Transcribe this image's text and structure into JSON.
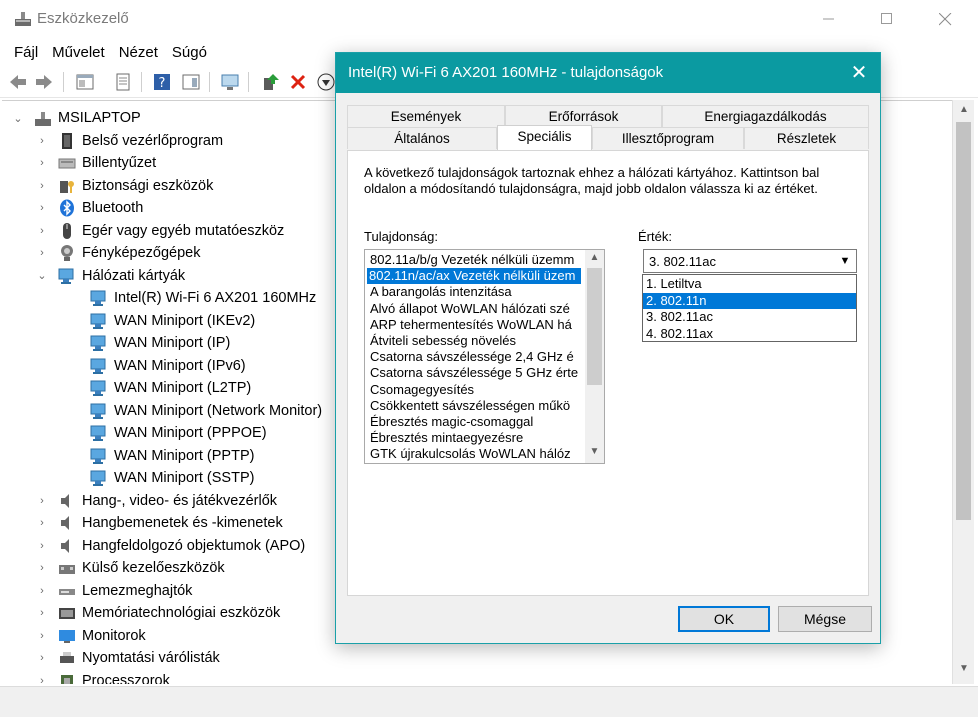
{
  "window": {
    "title": "Eszközkezelő"
  },
  "menu": [
    "Fájl",
    "Művelet",
    "Nézet",
    "Súgó"
  ],
  "tree": {
    "root": "MSILAPTOP",
    "categories_before": [
      "Belső vezérlőprogram",
      "Billentyűzet",
      "Biztonsági eszközök",
      "Bluetooth",
      "Egér vagy egyéb mutatóeszköz",
      "Fényképezőgépek"
    ],
    "expanded": {
      "label": "Hálózati kártyák",
      "children": [
        "Intel(R) Wi-Fi 6 AX201 160MHz",
        "WAN Miniport (IKEv2)",
        "WAN Miniport (IP)",
        "WAN Miniport (IPv6)",
        "WAN Miniport (L2TP)",
        "WAN Miniport (Network Monitor)",
        "WAN Miniport (PPPOE)",
        "WAN Miniport (PPTP)",
        "WAN Miniport (SSTP)"
      ]
    },
    "categories_after": [
      "Hang-, video- és játékvezérlők",
      "Hangbemenetek és -kimenetek",
      "Hangfeldolgozó objektumok (APO)",
      "Külső kezelőeszközök",
      "Lemezmeghajtók",
      "Memóriatechnológiai eszközök",
      "Monitorok",
      "Nyomtatási várólisták",
      "Processzorok"
    ]
  },
  "dialog": {
    "title": "Intel(R) Wi-Fi 6 AX201 160MHz - tulajdonságok",
    "close_glyph": "✕",
    "tabs_top": [
      "Események",
      "Erőforrások",
      "Energiagazdálkodás"
    ],
    "tabs_bottom": [
      "Általános",
      "Speciális",
      "Illesztőprogram",
      "Részletek"
    ],
    "active_tab": "Speciális",
    "description": "A következő tulajdonságok tartoznak ehhez a hálózati kártyához. Kattintson bal oldalon a módosítandó tulajdonságra, majd jobb oldalon válassza ki az értéket.",
    "property_label": "Tulajdonság:",
    "value_label": "Érték:",
    "properties": [
      "802.11a/b/g Vezeték nélküli üzemm",
      "802.11n/ac/ax Vezeték nélküli üzem",
      "A barangolás intenzitása",
      "Alvó állapot WoWLAN hálózati szé",
      "ARP tehermentesítés WoWLAN há",
      "Átviteli sebesség növelés",
      "Csatorna sávszélessége 2,4 GHz é",
      "Csatorna sávszélessége 5 GHz érte",
      "Csomagegyesítés",
      "Csökkentett sávszélességen műkö",
      "Ébresztés magic-csomaggal",
      "Ébresztés mintaegyezésre",
      "GTK újrakulcsolás WoWLAN hálóz"
    ],
    "selected_property_index": 1,
    "value_current": "3. 802.11ac",
    "value_options": [
      "1. Letiltva",
      "2. 802.11n",
      "3. 802.11ac",
      "4. 802.11ax"
    ],
    "highlighted_option_index": 1,
    "ok_label": "OK",
    "cancel_label": "Mégse"
  },
  "colors": {
    "accent": "#0b9aa1",
    "selection": "#0078d7"
  }
}
